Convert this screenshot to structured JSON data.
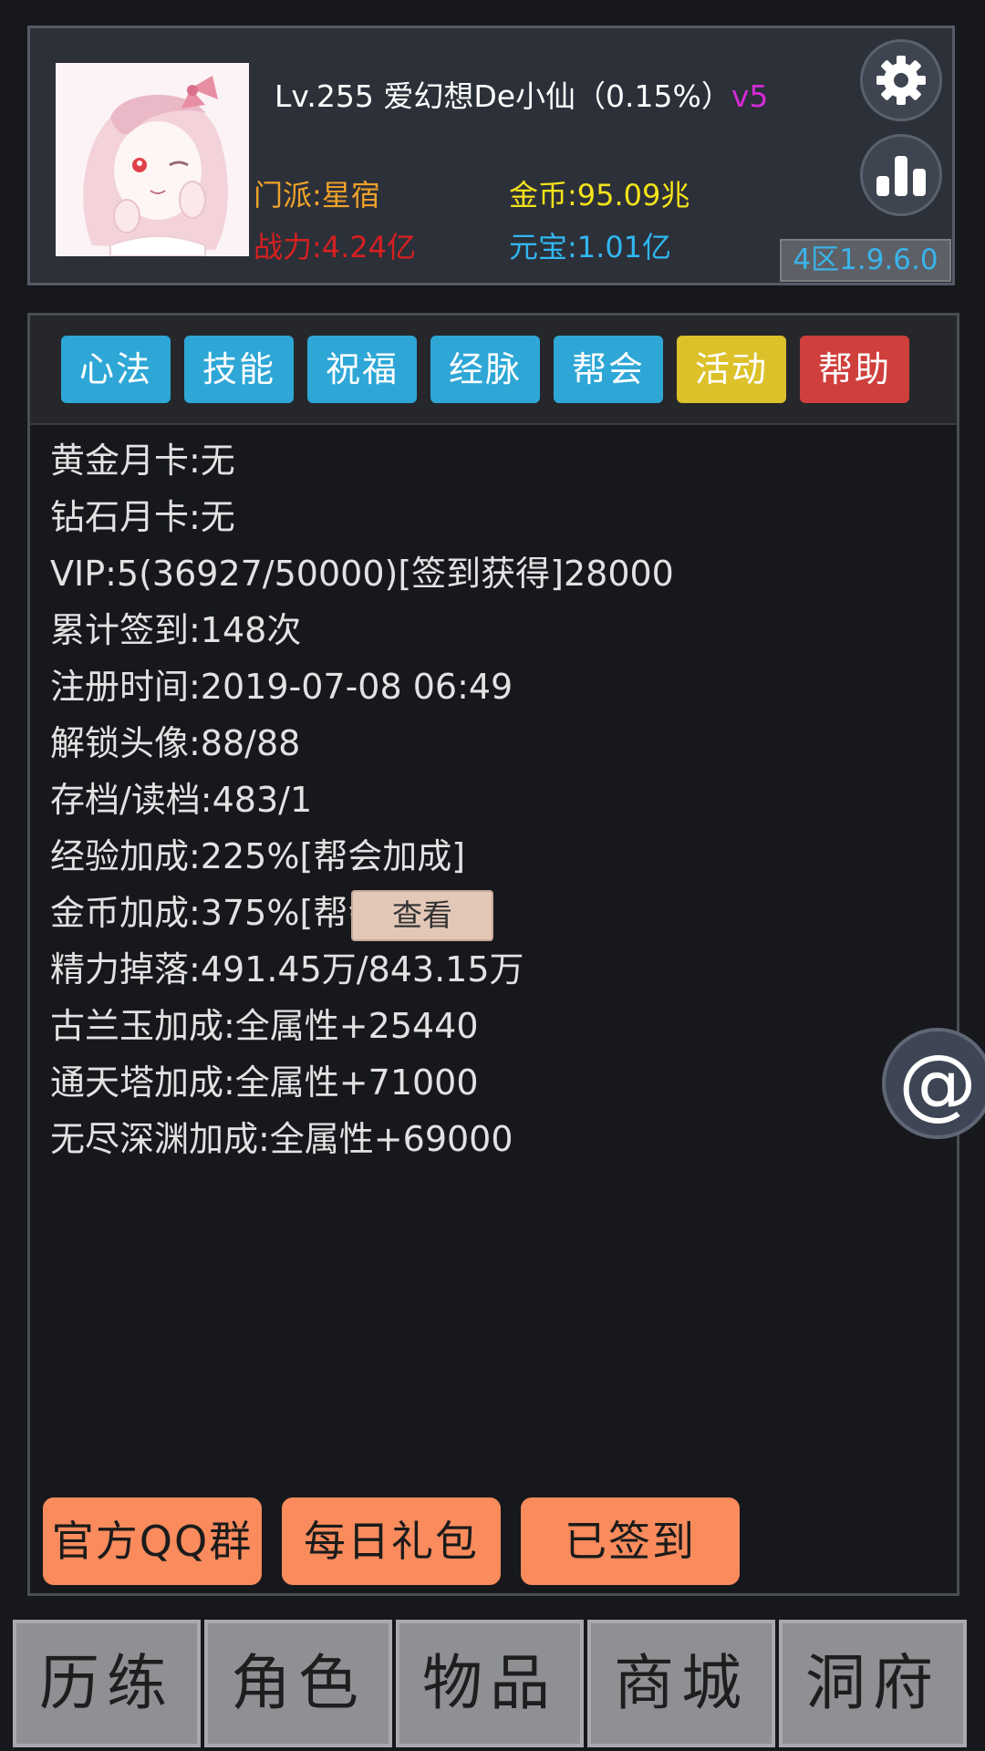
{
  "player": {
    "title_line": "Lv.255 爱幻想De小仙（0.15%）",
    "vip": "v5",
    "sect": "门派:星宿",
    "power": "战力:4.24亿",
    "gold": "金币:95.09兆",
    "ingot": "元宝:1.01亿",
    "server": "4区1.9.6.0"
  },
  "icons": {
    "settings": "gear-icon",
    "ranking": "bar-chart-icon",
    "mention": "at-sign-icon"
  },
  "tabs": [
    {
      "label": "心法",
      "color": "#2ea7d6"
    },
    {
      "label": "技能",
      "color": "#2ea7d6"
    },
    {
      "label": "祝福",
      "color": "#2ea7d6"
    },
    {
      "label": "经脉",
      "color": "#2ea7d6"
    },
    {
      "label": "帮会",
      "color": "#2ea7d6"
    },
    {
      "label": "活动",
      "color": "#dcc12a"
    },
    {
      "label": "帮助",
      "color": "#cf3f3c"
    }
  ],
  "info": [
    "黄金月卡:无",
    "钻石月卡:无",
    "VIP:5(36927/50000)[签到获得]28000",
    "累计签到:148次",
    "注册时间:2019-07-08 06:49",
    "解锁头像:88/88",
    "存档/读档:483/1",
    "经验加成:225%[帮会加成]",
    "金币加成:375%[帮会加成]",
    "精力掉落:491.45万/843.15万",
    "古兰玉加成:全属性+25440",
    "通天塔加成:全属性+71000",
    "无尽深渊加成:全属性+69000"
  ],
  "view_button": "查看",
  "actions": {
    "qq_group": "官方QQ群",
    "daily_gift": "每日礼包",
    "signed_in": "已签到"
  },
  "bottom_nav": [
    "历练",
    "角色",
    "物品",
    "商城",
    "洞府"
  ],
  "mention_symbol": "@"
}
